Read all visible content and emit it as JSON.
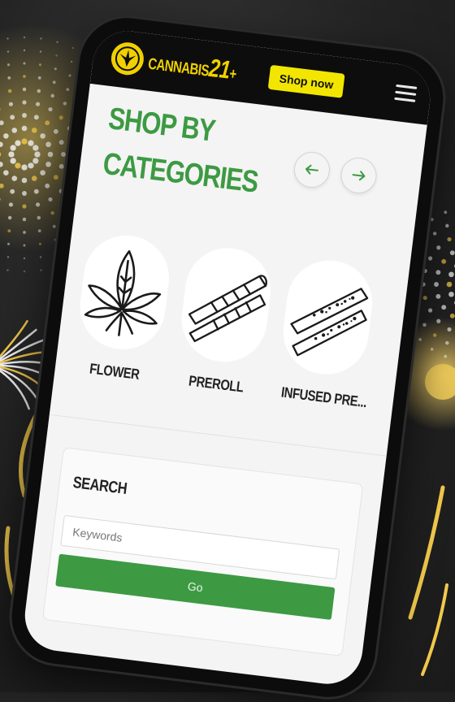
{
  "header": {
    "logo_word": "CANNABIS",
    "logo_num": "21",
    "logo_plus": "+",
    "shop_now_label": "Shop now"
  },
  "categories": {
    "title_line1": "SHOP BY",
    "title_line2": "CATEGORIES",
    "items": [
      {
        "label": "FLOWER",
        "icon": "cannabis-leaf-icon"
      },
      {
        "label": "PREROLL",
        "icon": "preroll-icon"
      },
      {
        "label": "INFUSED PRE...",
        "icon": "infused-preroll-icon"
      }
    ]
  },
  "search": {
    "title": "SEARCH",
    "placeholder": "Keywords",
    "value": "",
    "go_label": "Go"
  },
  "colors": {
    "brand_green": "#3d9a43",
    "brand_yellow": "#f2e600",
    "header_bg": "#0d0d0d"
  }
}
